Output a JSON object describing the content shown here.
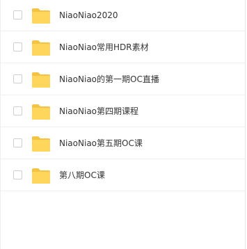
{
  "file_list": {
    "items": [
      {
        "name": "NiaoNiao2020",
        "icon": "folder-icon"
      },
      {
        "name": "NiaoNiao常用HDR素材",
        "icon": "folder-icon"
      },
      {
        "name": "NiaoNiao的第一期OC直播",
        "icon": "folder-icon"
      },
      {
        "name": "NiaoNiao第四期课程",
        "icon": "folder-icon"
      },
      {
        "name": "NiaoNiao第五期OC课",
        "icon": "folder-icon"
      },
      {
        "name": "第八期OC课",
        "icon": "folder-icon"
      }
    ]
  },
  "colors": {
    "folder_fill": "#FFD65C",
    "folder_tab": "#F5C342",
    "text": "#333333",
    "divider": "#F0F0F0"
  }
}
